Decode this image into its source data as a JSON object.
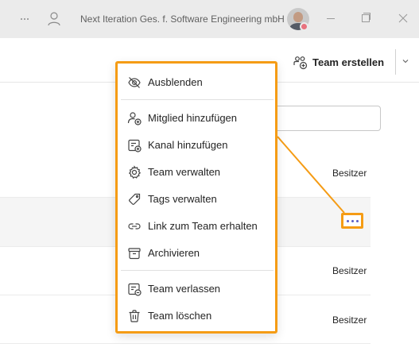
{
  "titlebar": {
    "org_name": "Next Iteration Ges. f. Software Engineering mbH",
    "more_icon": "more-horizontal-icon",
    "person_icon": "person-icon",
    "status_color": "#e8727e"
  },
  "header": {
    "create_team_label": "Team erstellen",
    "create_team_icon": "people-add-icon",
    "dropdown_icon": "chevron-down-icon"
  },
  "team_list": {
    "owner_labels": [
      "Besitzer",
      "Besitzer",
      "Besitzer"
    ],
    "more_options_icon": "more-horizontal-icon"
  },
  "context_menu": {
    "accent_color": "#f59c15",
    "items": [
      {
        "label": "Ausblenden",
        "icon": "eye-off-icon"
      },
      {
        "label": "Mitglied hinzufügen",
        "icon": "person-add-icon"
      },
      {
        "label": "Kanal hinzufügen",
        "icon": "channel-add-icon"
      },
      {
        "label": "Team verwalten",
        "icon": "gear-icon"
      },
      {
        "label": "Tags verwalten",
        "icon": "tag-icon"
      },
      {
        "label": "Link zum Team erhalten",
        "icon": "link-icon"
      },
      {
        "label": "Archivieren",
        "icon": "archive-icon"
      },
      {
        "label": "Team verlassen",
        "icon": "leave-icon"
      },
      {
        "label": "Team löschen",
        "icon": "trash-icon"
      }
    ]
  },
  "colors": {
    "accent": "#f59c15",
    "brand": "#5b5fc7",
    "titlebar_bg": "#ebebeb"
  }
}
